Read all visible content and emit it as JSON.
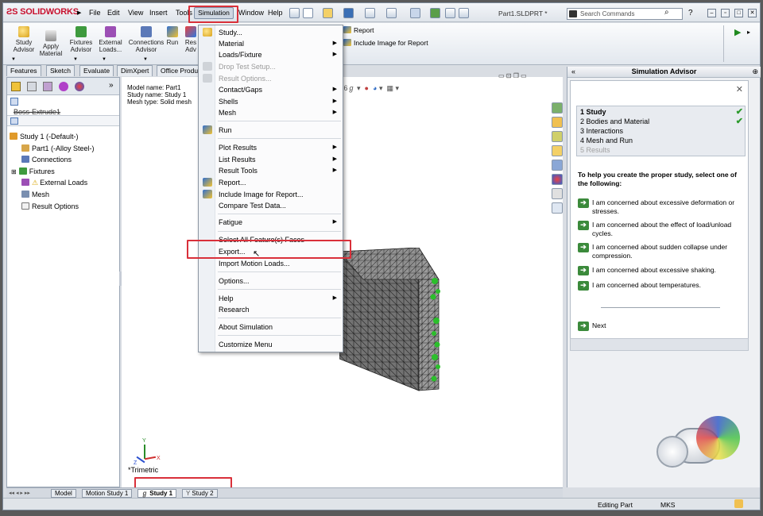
{
  "app": {
    "logo": "SOLIDWORKS",
    "doc_title": "Part1.SLDPRT *"
  },
  "menubar": {
    "items": [
      "File",
      "Edit",
      "View",
      "Insert",
      "Tools",
      "Simulation",
      "Window",
      "Help"
    ],
    "search_placeholder": "Search Commands"
  },
  "command_manager": {
    "buttons": [
      {
        "label": "Study\nAdvisor",
        "icon": "magnifier-icon"
      },
      {
        "label": "Apply\nMaterial",
        "icon": "material-icon"
      },
      {
        "label": "Fixtures\nAdvisor",
        "icon": "fixture-icon"
      },
      {
        "label": "External\nLoads...",
        "icon": "load-icon"
      },
      {
        "label": "Connections\nAdvisor",
        "icon": "connection-icon"
      },
      {
        "label": "Run",
        "icon": "run-icon"
      },
      {
        "label": "Res\nAdv",
        "icon": "results-icon"
      }
    ],
    "report": "Report",
    "include_image": "Include Image for Report"
  },
  "tabs": [
    "Features",
    "Sketch",
    "Evaluate",
    "DimXpert",
    "Office Produ"
  ],
  "feature_tree": {
    "filter_row": "Boss-Extrude1",
    "items": [
      {
        "label": "Study 1 (-Default-)",
        "icon": "study-icon"
      },
      {
        "label": "Part1 (-Alloy Steel-)",
        "icon": "part-icon"
      },
      {
        "label": "Connections",
        "icon": "connections-icon"
      },
      {
        "label": "Fixtures",
        "icon": "fixtures-icon"
      },
      {
        "label": "External Loads",
        "icon": "warning-icon"
      },
      {
        "label": "Mesh",
        "icon": "mesh-icon"
      },
      {
        "label": "Result Options",
        "icon": "result-options-icon"
      }
    ]
  },
  "graphics": {
    "model_name": "Model name: Part1",
    "study_name": "Study name: Study 1",
    "mesh_type": "Mesh type: Solid mesh",
    "view_label": "*Trimetric"
  },
  "simulation_menu": {
    "items": [
      {
        "label": "Study...",
        "submenu": false,
        "disabled": false
      },
      {
        "label": "Material",
        "submenu": true,
        "disabled": false
      },
      {
        "label": "Loads/Fixture",
        "submenu": true,
        "disabled": false
      },
      {
        "label": "Drop Test Setup...",
        "submenu": false,
        "disabled": true
      },
      {
        "label": "Result Options...",
        "submenu": false,
        "disabled": true
      },
      {
        "label": "Contact/Gaps",
        "submenu": true,
        "disabled": false
      },
      {
        "label": "Shells",
        "submenu": true,
        "disabled": false
      },
      {
        "label": "Mesh",
        "submenu": true,
        "disabled": false
      },
      {
        "label": "Run",
        "submenu": false,
        "disabled": false
      },
      {
        "label": "Plot Results",
        "submenu": true,
        "disabled": false
      },
      {
        "label": "List Results",
        "submenu": true,
        "disabled": false
      },
      {
        "label": "Result Tools",
        "submenu": true,
        "disabled": false
      },
      {
        "label": "Report...",
        "submenu": false,
        "disabled": false
      },
      {
        "label": "Include Image for Report...",
        "submenu": false,
        "disabled": false
      },
      {
        "label": "Compare Test Data...",
        "submenu": false,
        "disabled": false
      },
      {
        "label": "Fatigue",
        "submenu": true,
        "disabled": false
      },
      {
        "label": "Select All Feature(s) Faces",
        "submenu": false,
        "disabled": false
      },
      {
        "label": "Export...",
        "submenu": false,
        "disabled": false
      },
      {
        "label": "Import Motion Loads...",
        "submenu": false,
        "disabled": false
      },
      {
        "label": "Options...",
        "submenu": false,
        "disabled": false
      },
      {
        "label": "Help",
        "submenu": true,
        "disabled": false
      },
      {
        "label": "Research",
        "submenu": false,
        "disabled": false
      },
      {
        "label": "About Simulation",
        "submenu": false,
        "disabled": false
      },
      {
        "label": "Customize Menu",
        "submenu": false,
        "disabled": false
      }
    ]
  },
  "advisor": {
    "title": "Simulation Advisor",
    "steps": [
      {
        "num": "1",
        "label": "Study",
        "done": true
      },
      {
        "num": "2",
        "label": "Bodies and Material",
        "done": true
      },
      {
        "num": "3",
        "label": "Interactions",
        "done": false
      },
      {
        "num": "4",
        "label": "Mesh and Run",
        "done": false
      },
      {
        "num": "5",
        "label": "Results",
        "done": false
      }
    ],
    "prompt": "To help you create the proper study, select one of the following:",
    "options": [
      "I am concerned about excessive deformation or stresses.",
      "I am concerned about the effect of load/unload cycles.",
      "I am concerned about sudden collapse under compression.",
      "I am concerned about excessive shaking.",
      "I am concerned about temperatures."
    ],
    "next": "Next"
  },
  "bottom_tabs": [
    "Model",
    "Motion Study 1",
    "Study 1",
    "Study 2"
  ],
  "status": {
    "mode": "Editing Part",
    "units": "MKS"
  }
}
